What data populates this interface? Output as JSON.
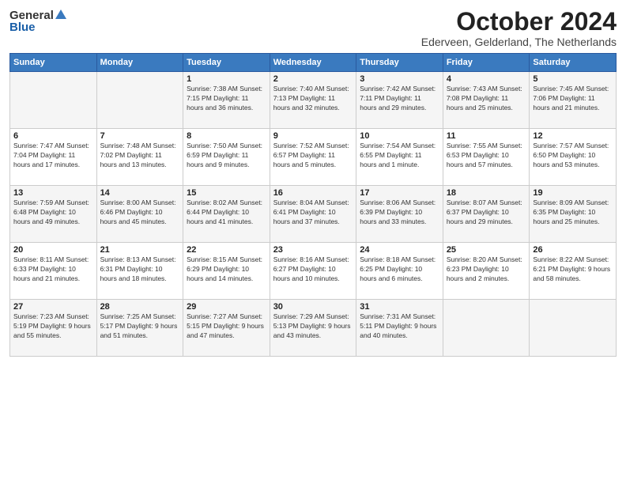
{
  "header": {
    "logo_general": "General",
    "logo_blue": "Blue",
    "month_title": "October 2024",
    "location": "Ederveen, Gelderland, The Netherlands"
  },
  "days_of_week": [
    "Sunday",
    "Monday",
    "Tuesday",
    "Wednesday",
    "Thursday",
    "Friday",
    "Saturday"
  ],
  "weeks": [
    [
      {
        "day": "",
        "info": ""
      },
      {
        "day": "",
        "info": ""
      },
      {
        "day": "1",
        "info": "Sunrise: 7:38 AM\nSunset: 7:15 PM\nDaylight: 11 hours and 36 minutes."
      },
      {
        "day": "2",
        "info": "Sunrise: 7:40 AM\nSunset: 7:13 PM\nDaylight: 11 hours and 32 minutes."
      },
      {
        "day": "3",
        "info": "Sunrise: 7:42 AM\nSunset: 7:11 PM\nDaylight: 11 hours and 29 minutes."
      },
      {
        "day": "4",
        "info": "Sunrise: 7:43 AM\nSunset: 7:08 PM\nDaylight: 11 hours and 25 minutes."
      },
      {
        "day": "5",
        "info": "Sunrise: 7:45 AM\nSunset: 7:06 PM\nDaylight: 11 hours and 21 minutes."
      }
    ],
    [
      {
        "day": "6",
        "info": "Sunrise: 7:47 AM\nSunset: 7:04 PM\nDaylight: 11 hours and 17 minutes."
      },
      {
        "day": "7",
        "info": "Sunrise: 7:48 AM\nSunset: 7:02 PM\nDaylight: 11 hours and 13 minutes."
      },
      {
        "day": "8",
        "info": "Sunrise: 7:50 AM\nSunset: 6:59 PM\nDaylight: 11 hours and 9 minutes."
      },
      {
        "day": "9",
        "info": "Sunrise: 7:52 AM\nSunset: 6:57 PM\nDaylight: 11 hours and 5 minutes."
      },
      {
        "day": "10",
        "info": "Sunrise: 7:54 AM\nSunset: 6:55 PM\nDaylight: 11 hours and 1 minute."
      },
      {
        "day": "11",
        "info": "Sunrise: 7:55 AM\nSunset: 6:53 PM\nDaylight: 10 hours and 57 minutes."
      },
      {
        "day": "12",
        "info": "Sunrise: 7:57 AM\nSunset: 6:50 PM\nDaylight: 10 hours and 53 minutes."
      }
    ],
    [
      {
        "day": "13",
        "info": "Sunrise: 7:59 AM\nSunset: 6:48 PM\nDaylight: 10 hours and 49 minutes."
      },
      {
        "day": "14",
        "info": "Sunrise: 8:00 AM\nSunset: 6:46 PM\nDaylight: 10 hours and 45 minutes."
      },
      {
        "day": "15",
        "info": "Sunrise: 8:02 AM\nSunset: 6:44 PM\nDaylight: 10 hours and 41 minutes."
      },
      {
        "day": "16",
        "info": "Sunrise: 8:04 AM\nSunset: 6:41 PM\nDaylight: 10 hours and 37 minutes."
      },
      {
        "day": "17",
        "info": "Sunrise: 8:06 AM\nSunset: 6:39 PM\nDaylight: 10 hours and 33 minutes."
      },
      {
        "day": "18",
        "info": "Sunrise: 8:07 AM\nSunset: 6:37 PM\nDaylight: 10 hours and 29 minutes."
      },
      {
        "day": "19",
        "info": "Sunrise: 8:09 AM\nSunset: 6:35 PM\nDaylight: 10 hours and 25 minutes."
      }
    ],
    [
      {
        "day": "20",
        "info": "Sunrise: 8:11 AM\nSunset: 6:33 PM\nDaylight: 10 hours and 21 minutes."
      },
      {
        "day": "21",
        "info": "Sunrise: 8:13 AM\nSunset: 6:31 PM\nDaylight: 10 hours and 18 minutes."
      },
      {
        "day": "22",
        "info": "Sunrise: 8:15 AM\nSunset: 6:29 PM\nDaylight: 10 hours and 14 minutes."
      },
      {
        "day": "23",
        "info": "Sunrise: 8:16 AM\nSunset: 6:27 PM\nDaylight: 10 hours and 10 minutes."
      },
      {
        "day": "24",
        "info": "Sunrise: 8:18 AM\nSunset: 6:25 PM\nDaylight: 10 hours and 6 minutes."
      },
      {
        "day": "25",
        "info": "Sunrise: 8:20 AM\nSunset: 6:23 PM\nDaylight: 10 hours and 2 minutes."
      },
      {
        "day": "26",
        "info": "Sunrise: 8:22 AM\nSunset: 6:21 PM\nDaylight: 9 hours and 58 minutes."
      }
    ],
    [
      {
        "day": "27",
        "info": "Sunrise: 7:23 AM\nSunset: 5:19 PM\nDaylight: 9 hours and 55 minutes."
      },
      {
        "day": "28",
        "info": "Sunrise: 7:25 AM\nSunset: 5:17 PM\nDaylight: 9 hours and 51 minutes."
      },
      {
        "day": "29",
        "info": "Sunrise: 7:27 AM\nSunset: 5:15 PM\nDaylight: 9 hours and 47 minutes."
      },
      {
        "day": "30",
        "info": "Sunrise: 7:29 AM\nSunset: 5:13 PM\nDaylight: 9 hours and 43 minutes."
      },
      {
        "day": "31",
        "info": "Sunrise: 7:31 AM\nSunset: 5:11 PM\nDaylight: 9 hours and 40 minutes."
      },
      {
        "day": "",
        "info": ""
      },
      {
        "day": "",
        "info": ""
      }
    ]
  ]
}
